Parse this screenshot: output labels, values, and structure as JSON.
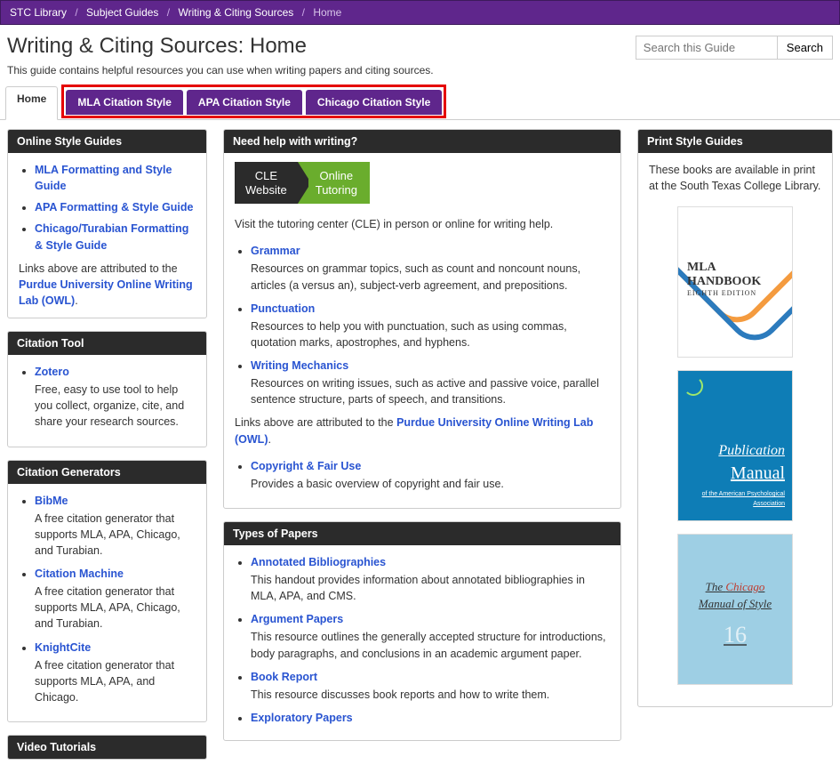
{
  "breadcrumbs": {
    "items": [
      "STC Library",
      "Subject Guides",
      "Writing & Citing Sources"
    ],
    "current": "Home"
  },
  "page": {
    "title": "Writing & Citing Sources: Home",
    "subtitle": "This guide contains helpful resources you can use when writing papers and citing sources."
  },
  "search": {
    "placeholder": "Search this Guide",
    "button": "Search"
  },
  "tabs": {
    "active": "Home",
    "others": [
      "MLA Citation Style",
      "APA Citation Style",
      "Chicago Citation Style"
    ]
  },
  "left": {
    "online_style": {
      "title": "Online Style Guides",
      "items": [
        "MLA Formatting and Style Guide",
        "APA Formatting & Style Guide",
        "Chicago/Turabian Formatting & Style Guide"
      ],
      "attrib_prefix": "Links above are attributed to the ",
      "attrib_link": "Purdue University Online Writing Lab (OWL)",
      "attrib_suffix": "."
    },
    "citation_tool": {
      "title": "Citation Tool",
      "item": "Zotero",
      "desc": "Free, easy to use tool to help you collect, organize, cite, and share your research sources."
    },
    "citation_gen": {
      "title": "Citation Generators",
      "items": [
        {
          "name": "BibMe",
          "desc": "A free citation generator that supports MLA, APA, Chicago, and Turabian."
        },
        {
          "name": "Citation Machine",
          "desc": "A free citation generator that supports MLA, APA, Chicago, and Turabian."
        },
        {
          "name": "KnightCite",
          "desc": "A free citation generator that supports MLA, APA, and Chicago."
        }
      ]
    },
    "video": {
      "title": "Video Tutorials"
    }
  },
  "mid": {
    "need_help": {
      "title": "Need help with writing?",
      "badge_left_1": "CLE",
      "badge_left_2": "Website",
      "badge_right_1": "Online",
      "badge_right_2": "Tutoring",
      "intro": "Visit the tutoring center (CLE) in person or online for writing help.",
      "items": [
        {
          "name": "Grammar",
          "desc": "Resources on grammar topics, such as count and noncount nouns, articles (a versus an), subject-verb agreement, and prepositions."
        },
        {
          "name": "Punctuation",
          "desc": "Resources to help you with punctuation, such as using commas, quotation marks, apostrophes, and hyphens."
        },
        {
          "name": "Writing Mechanics",
          "desc": "Resources on writing issues, such as active and passive voice, parallel sentence structure, parts of speech, and transitions."
        }
      ],
      "attrib_prefix": "Links above are attributed to the ",
      "attrib_link": "Purdue University Online Writing Lab (OWL)",
      "attrib_suffix": ".",
      "copyright": {
        "name": "Copyright & Fair Use",
        "desc": "Provides a basic overview of copyright and fair use."
      }
    },
    "types": {
      "title": "Types of Papers",
      "items": [
        {
          "name": "Annotated Bibliographies",
          "desc": "This handout provides information about annotated bibliographies in MLA, APA, and CMS."
        },
        {
          "name": "Argument Papers",
          "desc": "This resource outlines the generally accepted structure for introductions, body paragraphs, and conclusions in an academic argument paper."
        },
        {
          "name": "Book Report",
          "desc": "This resource discusses book reports and how to write them."
        },
        {
          "name": "Exploratory Papers",
          "desc": ""
        }
      ]
    }
  },
  "right": {
    "title": "Print Style Guides",
    "intro": "These books are available in print at the South Texas College Library.",
    "mla": {
      "line1": "MLA",
      "line2": "HANDBOOK",
      "edition": "EIGHTH EDITION"
    },
    "apa": {
      "line1": "Publication",
      "line2": "Manual",
      "sub": "of the American Psychological Association"
    },
    "chicago": {
      "t1a": "The ",
      "t1b": "Chicago",
      "t2": "Manual of Style",
      "num": "16"
    }
  }
}
